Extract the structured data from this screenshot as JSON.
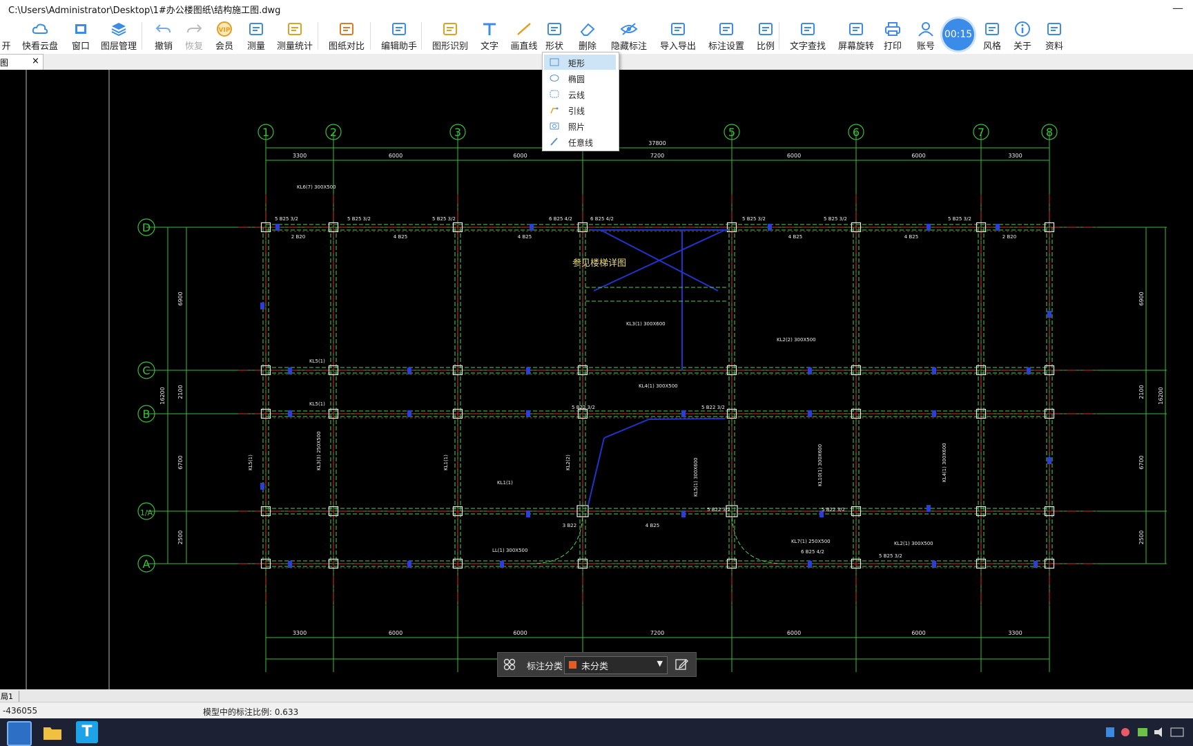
{
  "window": {
    "title": "C:\\Users\\Administrator\\Desktop\\1#办公楼图纸\\结构施工图.dwg",
    "close_glyph": "—"
  },
  "toolbar": {
    "items": [
      {
        "label": "开",
        "icon": "open-icon"
      },
      {
        "label": "快看云盘",
        "icon": "cloud-icon"
      },
      {
        "label": "窗口",
        "icon": "window-icon"
      },
      {
        "label": "图层管理",
        "icon": "layers-icon"
      },
      {
        "label": "撤销",
        "icon": "undo-icon"
      },
      {
        "label": "恢复",
        "icon": "redo-icon"
      },
      {
        "label": "会员",
        "icon": "vip-icon"
      },
      {
        "label": "测量",
        "icon": "measure-icon"
      },
      {
        "label": "测量统计",
        "icon": "measure-stats-icon"
      },
      {
        "label": "图纸对比",
        "icon": "compare-icon"
      },
      {
        "label": "编辑助手",
        "icon": "edit-assistant-icon"
      },
      {
        "label": "图形识别",
        "icon": "shape-recognize-icon"
      },
      {
        "label": "文字",
        "icon": "text-icon"
      },
      {
        "label": "画直线",
        "icon": "line-icon"
      },
      {
        "label": "形状",
        "icon": "shape-icon"
      },
      {
        "label": "删除",
        "icon": "eraser-icon"
      },
      {
        "label": "隐藏标注",
        "icon": "eye-hide-icon"
      },
      {
        "label": "导入导出",
        "icon": "import-export-icon"
      },
      {
        "label": "标注设置",
        "icon": "annotation-settings-icon"
      },
      {
        "label": "比例",
        "icon": "scale-icon"
      },
      {
        "label": "文字查找",
        "icon": "text-search-icon"
      },
      {
        "label": "屏幕旋转",
        "icon": "rotate-screen-icon"
      },
      {
        "label": "打印",
        "icon": "print-icon"
      },
      {
        "label": "账号",
        "icon": "account-icon"
      },
      {
        "label": "风格",
        "icon": "style-icon"
      },
      {
        "label": "关于",
        "icon": "about-icon"
      },
      {
        "label": "资料",
        "icon": "docs-icon"
      }
    ],
    "timer": "00:15",
    "accent_color": "#3b8be8"
  },
  "tab": {
    "label": "图",
    "close": "×"
  },
  "shape_menu": {
    "items": [
      {
        "label": "矩形",
        "icon": "rectangle-icon",
        "selected": true
      },
      {
        "label": "椭圆",
        "icon": "ellipse-icon"
      },
      {
        "label": "云线",
        "icon": "cloud-line-icon"
      },
      {
        "label": "引线",
        "icon": "leader-line-icon"
      },
      {
        "label": "照片",
        "icon": "photo-icon"
      },
      {
        "label": "任意线",
        "icon": "freehand-icon"
      }
    ]
  },
  "drawing": {
    "axes_numbers": [
      "1",
      "2",
      "3",
      "5",
      "6",
      "7",
      "8"
    ],
    "axes_letters": [
      "D",
      "C",
      "B",
      "1/A",
      "A"
    ],
    "top_spans": [
      "3300",
      "6000",
      "6000",
      "7200",
      "6000",
      "6000",
      "3300"
    ],
    "bottom_spans": [
      "3300",
      "6000",
      "6000",
      "7200",
      "6000",
      "6000",
      "3300"
    ],
    "total_width": "37800",
    "stair_note": "参见楼梯详图",
    "left_dims": [
      "6900",
      "2100",
      "6700",
      "2500"
    ],
    "left_total": "16200",
    "right_dims": [
      "6900",
      "2100",
      "6700",
      "2500"
    ],
    "right_total": "16200",
    "beam_labels": [
      "KL6(7) 300X500",
      "KL5(1)",
      "KL5(1)",
      "KL5(1)",
      "KL3(3) 250X500",
      "KL1(1)",
      "KL2(2)",
      "KL1(1)",
      "LL(1) 300X500",
      "KL3(1) 300X600",
      "KL4(1) 300X500",
      "KL5(1) 300X600",
      "KL2(2) 300X500",
      "KL10(1) 300X600",
      "KL4(1) 300X600",
      "KL2(1) 300X500",
      "KL7(1) 250X500"
    ],
    "rebar_labels": [
      "5 B25 3/2",
      "5 B25 3/2",
      "5 B25 3/2",
      "6 B25 4/2",
      "6 B25 4/2",
      "5 B25 3/2",
      "5 B25 3/2",
      "5 B25 3/2",
      "4 B25",
      "4 B25",
      "4 B25",
      "4 B25",
      "2 B20",
      "2 B20",
      "5 B22 3/2",
      "5 B22 3/2",
      "5 B22 3/2",
      "5 B22 3/2",
      "3 B22",
      "4 B25",
      "6 B25 4/2",
      "5 B25 3/2"
    ]
  },
  "annotation_bar": {
    "label": "标注分类",
    "value": "未分类",
    "swatch_color": "#e85a1e"
  },
  "layout_tab": "局1",
  "status": {
    "coords": "-436055",
    "scale_text": "模型中的标注比例: 0.633"
  }
}
